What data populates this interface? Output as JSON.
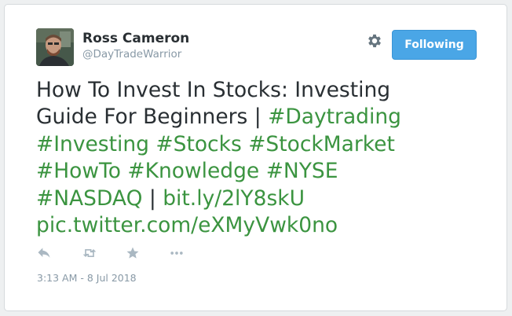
{
  "user": {
    "name": "Ross Cameron",
    "handle": "@DayTradeWarrior"
  },
  "follow_button": {
    "label": "Following"
  },
  "tweet": {
    "lines": [
      [
        {
          "text": "How To Invest In Stocks: Investing",
          "link": false
        }
      ],
      [
        {
          "text": "Guide For Beginners | ",
          "link": false
        },
        {
          "text": "#Daytrading",
          "link": true
        }
      ],
      [
        {
          "text": "#Investing",
          "link": true
        },
        {
          "text": " ",
          "link": false
        },
        {
          "text": "#Stocks",
          "link": true
        },
        {
          "text": " ",
          "link": false
        },
        {
          "text": "#StockMarket",
          "link": true
        }
      ],
      [
        {
          "text": "#HowTo",
          "link": true
        },
        {
          "text": " ",
          "link": false
        },
        {
          "text": "#Knowledge",
          "link": true
        },
        {
          "text": " ",
          "link": false
        },
        {
          "text": "#NYSE",
          "link": true
        }
      ],
      [
        {
          "text": "#NASDAQ",
          "link": true
        },
        {
          "text": " | ",
          "link": false
        },
        {
          "text": "bit.ly/2lY8skU",
          "link": true
        }
      ],
      [
        {
          "text": "pic.twitter.com/eXMyVwk0no",
          "link": true
        }
      ]
    ]
  },
  "actions": [
    {
      "name": "reply-icon"
    },
    {
      "name": "retweet-icon"
    },
    {
      "name": "like-icon"
    },
    {
      "name": "more-icon"
    }
  ],
  "timestamp": "3:13 AM - 8 Jul 2018",
  "colors": {
    "link": "#3b9440",
    "button": "#4aa6e6",
    "muted": "#8899a6",
    "text": "#292f33"
  }
}
